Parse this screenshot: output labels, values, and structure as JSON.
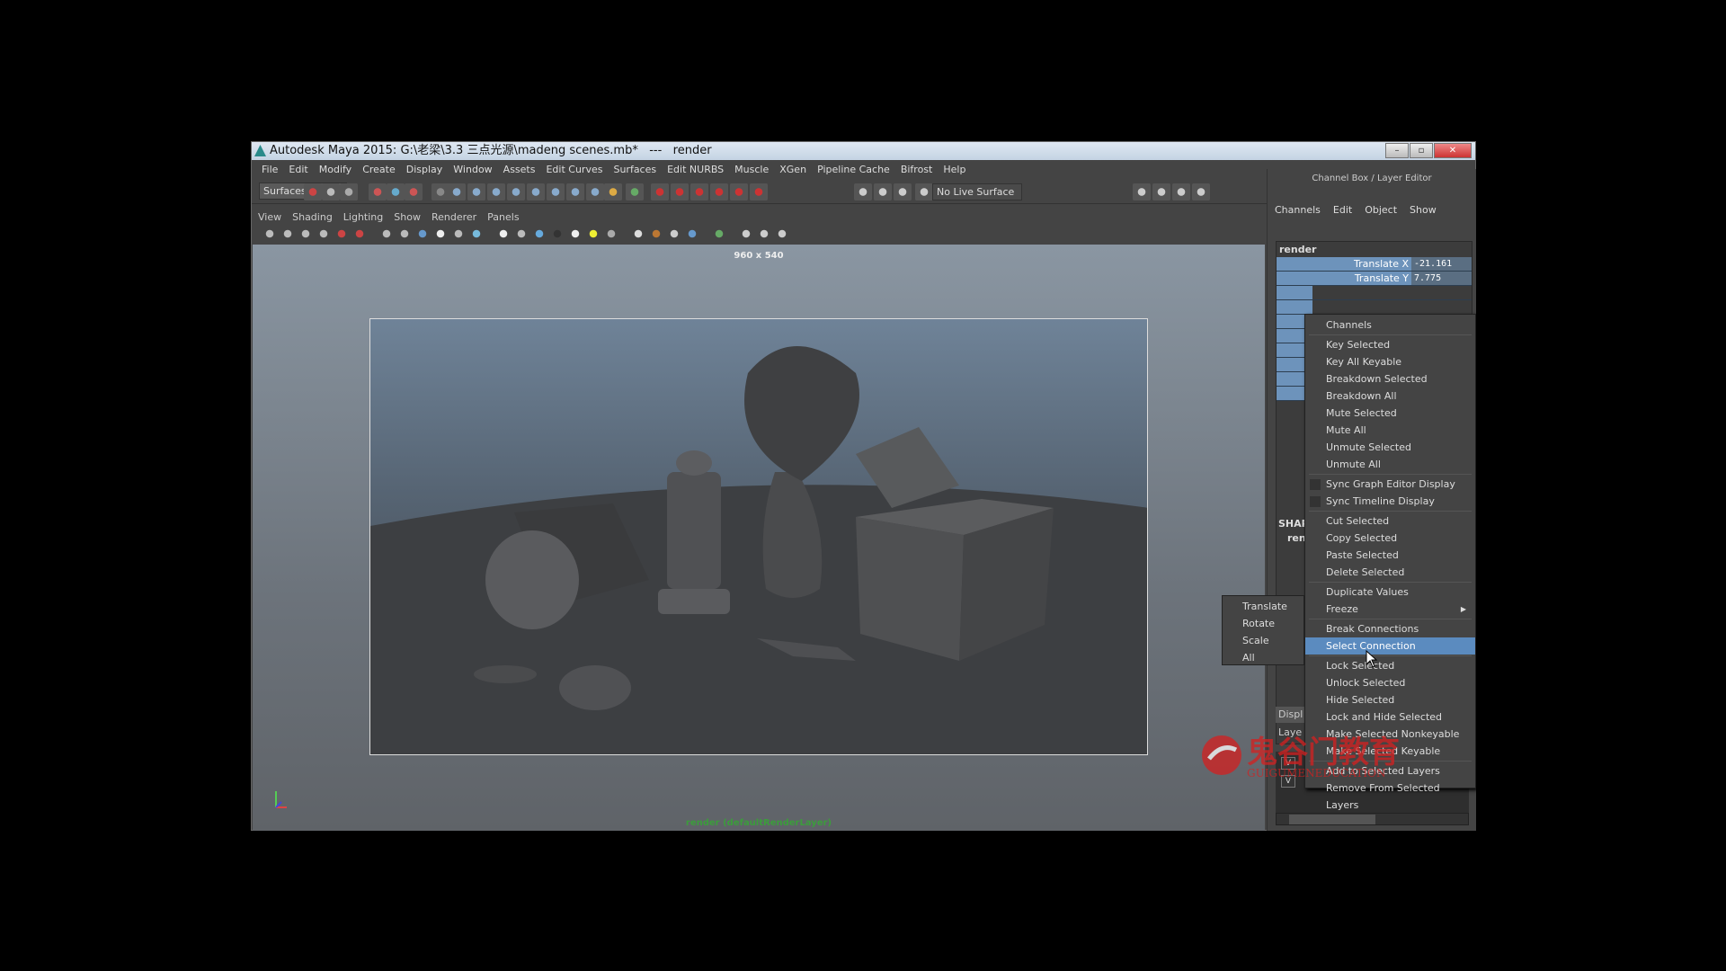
{
  "window": {
    "title": "Autodesk Maya 2015: G:\\老梁\\3.3 三点光源\\madeng scenes.mb*   ---   render"
  },
  "menubar": [
    "File",
    "Edit",
    "Modify",
    "Create",
    "Display",
    "Window",
    "Assets",
    "Edit Curves",
    "Surfaces",
    "Edit NURBS",
    "Muscle",
    "XGen",
    "Pipeline Cache",
    "Bifrost",
    "Help"
  ],
  "toolbar": {
    "menuset": "Surfaces",
    "live_surface": "No Live Surface"
  },
  "panel_menu": [
    "View",
    "Shading",
    "Lighting",
    "Show",
    "Renderer",
    "Panels"
  ],
  "viewport": {
    "resolution": "960 x 540",
    "camera_label": "render (defaultRenderLayer)"
  },
  "channel_box": {
    "title": "Channel Box / Layer Editor",
    "menu": [
      "Channels",
      "Edit",
      "Object",
      "Show"
    ],
    "object": "render",
    "channels": [
      {
        "label": "Translate X",
        "value": "-21.161"
      },
      {
        "label": "Translate Y",
        "value": "7.775"
      }
    ],
    "shapes_label": "SHAP",
    "shape_name": "ren",
    "display_tab": "Displ",
    "layers_tab": "Laye",
    "layer_vis": [
      "V",
      "V"
    ]
  },
  "context_menu": {
    "groups": [
      [
        {
          "label": "Channels"
        }
      ],
      [
        {
          "label": "Key Selected"
        },
        {
          "label": "Key All Keyable"
        },
        {
          "label": "Breakdown Selected"
        },
        {
          "label": "Breakdown All"
        },
        {
          "label": "Mute Selected"
        },
        {
          "label": "Mute All"
        },
        {
          "label": "Unmute Selected"
        },
        {
          "label": "Unmute All"
        }
      ],
      [
        {
          "label": "Sync Graph Editor Display",
          "checkbox": true
        },
        {
          "label": "Sync Timeline Display",
          "checkbox": true
        }
      ],
      [
        {
          "label": "Cut Selected"
        },
        {
          "label": "Copy Selected"
        },
        {
          "label": "Paste Selected"
        },
        {
          "label": "Delete Selected"
        }
      ],
      [
        {
          "label": "Duplicate Values"
        },
        {
          "label": "Freeze",
          "submenu": true
        }
      ],
      [
        {
          "label": "Break Connections"
        },
        {
          "label": "Select Connection",
          "highlighted": true
        }
      ],
      [
        {
          "label": "Lock Selected"
        },
        {
          "label": "Unlock Selected"
        },
        {
          "label": "Hide Selected"
        },
        {
          "label": "Lock and Hide Selected"
        },
        {
          "label": "Make Selected Nonkeyable"
        },
        {
          "label": "Make Selected Keyable"
        }
      ],
      [
        {
          "label": "Add to Selected Layers"
        },
        {
          "label": "Remove From Selected Layers"
        }
      ]
    ]
  },
  "freeze_submenu": [
    "Translate",
    "Rotate",
    "Scale",
    "All"
  ],
  "watermark": {
    "text": "鬼谷门教育",
    "subtext": "GUIGUMENEDUCATION"
  },
  "colors": {
    "highlight": "#5b8bbf",
    "channel_label": "#6d93bb",
    "watermark": "#d42020"
  }
}
